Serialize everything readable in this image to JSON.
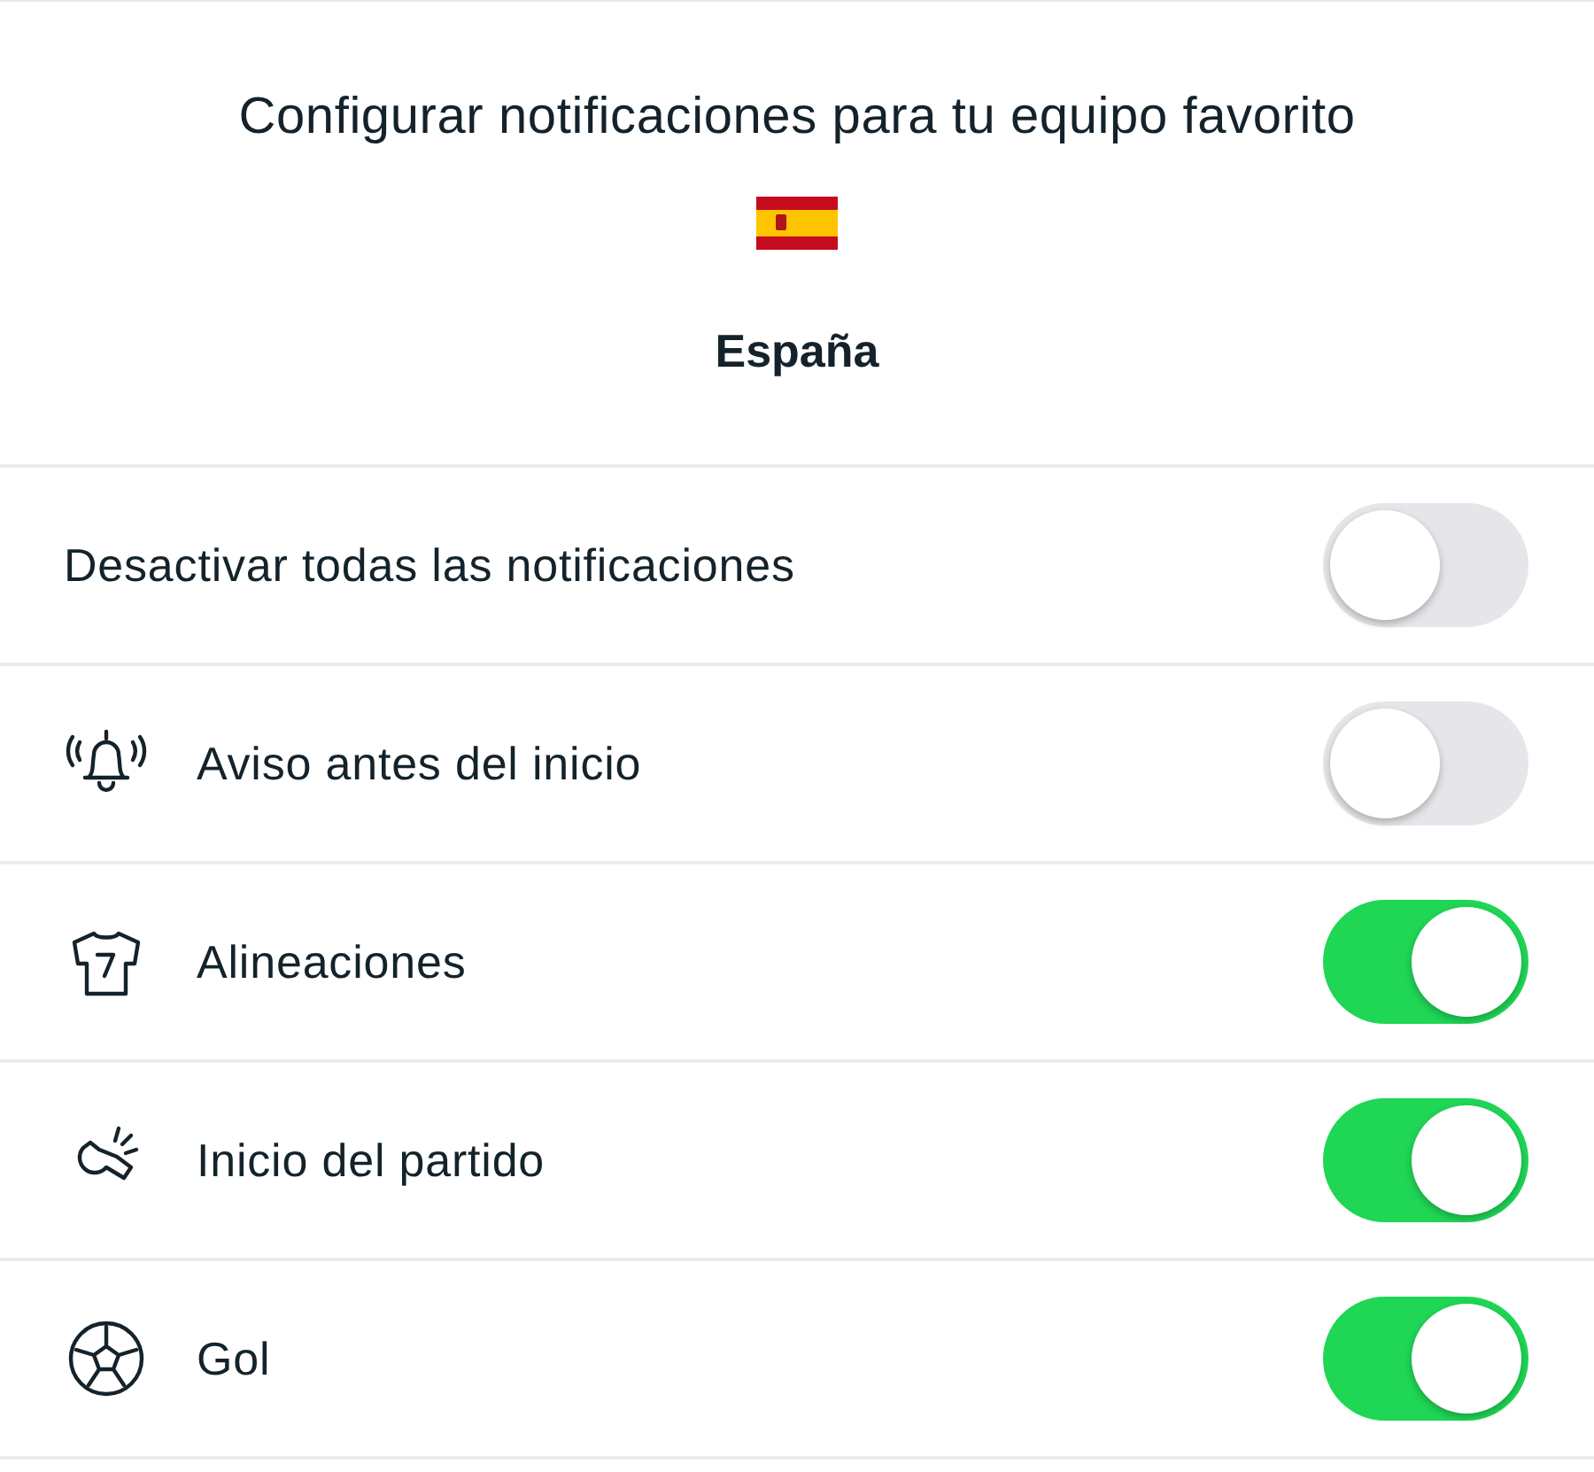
{
  "header": {
    "title": "Configurar notificaciones para tu equipo favorito",
    "team": "España"
  },
  "settings": [
    {
      "kind": "plain",
      "label": "Desactivar todas las notificaciones",
      "on": false
    },
    {
      "kind": "icon",
      "label": "Aviso antes del inicio",
      "on": false
    },
    {
      "kind": "icon",
      "label": "Alineaciones",
      "on": true
    },
    {
      "kind": "icon",
      "label": "Inicio del partido",
      "on": true
    },
    {
      "kind": "icon",
      "label": "Gol",
      "on": true
    }
  ]
}
